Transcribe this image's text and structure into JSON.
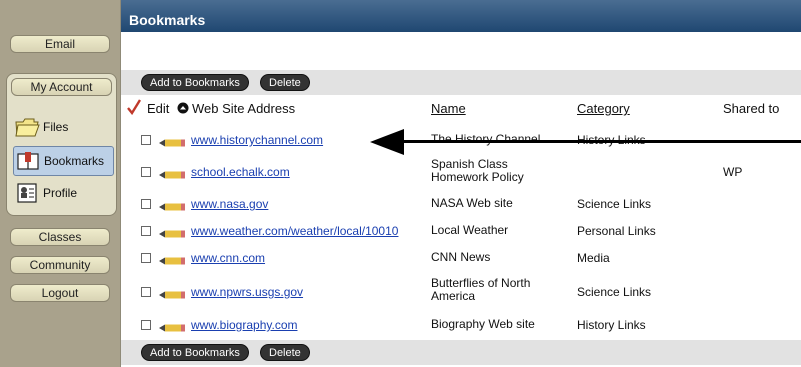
{
  "sidebar": {
    "email_label": "Email",
    "my_account_label": "My Account",
    "items": [
      {
        "label": "Files",
        "icon": "folder-icon"
      },
      {
        "label": "Bookmarks",
        "icon": "bookmarks-icon",
        "active": true
      },
      {
        "label": "Profile",
        "icon": "profile-icon"
      }
    ],
    "classes_label": "Classes",
    "community_label": "Community",
    "logout_label": "Logout"
  },
  "header": {
    "title": "Bookmarks"
  },
  "toolbar": {
    "add_label": "Add to Bookmarks",
    "delete_label": "Delete"
  },
  "table": {
    "columns": {
      "edit": "Edit",
      "address": "Web Site Address",
      "name": "Name",
      "category": "Category",
      "shared": "Shared to"
    },
    "rows": [
      {
        "url": "www.historychannel.com",
        "name": "The History Channel",
        "category": "History Links",
        "shared": ""
      },
      {
        "url": "school.echalk.com",
        "name": "Spanish Class Homework Policy",
        "category": "",
        "shared": "WP"
      },
      {
        "url": "www.nasa.gov",
        "name": "NASA Web site",
        "category": "Science Links",
        "shared": ""
      },
      {
        "url": "www.weather.com/weather/local/10010",
        "name": "Local Weather",
        "category": "Personal Links",
        "shared": ""
      },
      {
        "url": "www.cnn.com",
        "name": "CNN News",
        "category": "Media",
        "shared": ""
      },
      {
        "url": "www.npwrs.usgs.gov",
        "name": "Butterflies of North America",
        "category": "Science Links",
        "shared": ""
      },
      {
        "url": "www.biography.com",
        "name": "Biography Web site",
        "category": "History Links",
        "shared": ""
      }
    ]
  },
  "colors": {
    "sidebar_bg": "#a9a28c",
    "header_bar": "#1f4771",
    "link": "#1a3fb0",
    "check_mark": "#c0392b"
  }
}
